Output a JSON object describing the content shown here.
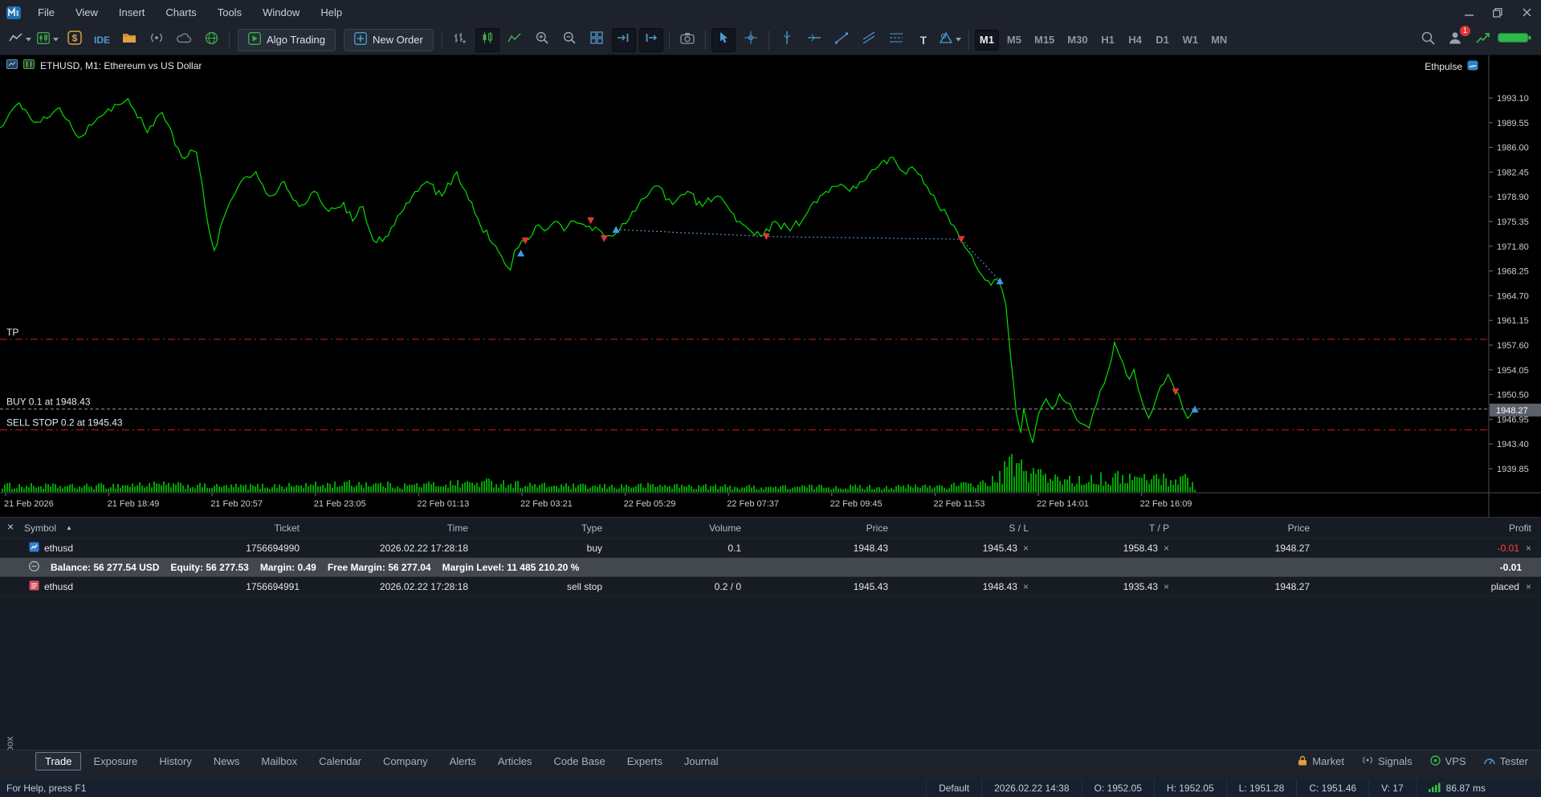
{
  "menubar": {
    "items": [
      "File",
      "View",
      "Insert",
      "Charts",
      "Tools",
      "Window",
      "Help"
    ]
  },
  "toolbar": {
    "ide_label": "IDE",
    "algo_trading_label": "Algo Trading",
    "new_order_label": "New Order",
    "text_tool_glyph": "T",
    "timeframes": [
      "M1",
      "M5",
      "M15",
      "M30",
      "H1",
      "H4",
      "D1",
      "W1",
      "MN"
    ],
    "active_timeframe": "M1",
    "notification_badge": "1"
  },
  "chart": {
    "header": "ETHUSD, M1:  Ethereum vs US Dollar",
    "overlay_right": "Ethpulse",
    "price_scale": [
      "1993.10",
      "1989.55",
      "1986.00",
      "1982.45",
      "1978.90",
      "1975.35",
      "1971.80",
      "1968.25",
      "1964.70",
      "1961.15",
      "1957.60",
      "1954.05",
      "1950.50",
      "1946.95",
      "1943.40",
      "1939.85"
    ],
    "current_price": "1948.27",
    "time_axis": [
      "21 Feb 2026",
      "21 Feb 18:49",
      "21 Feb 20:57",
      "21 Feb 23:05",
      "22 Feb 01:13",
      "22 Feb 03:21",
      "22 Feb 05:29",
      "22 Feb 07:37",
      "22 Feb 09:45",
      "22 Feb 11:53",
      "22 Feb 14:01",
      "22 Feb 16:09"
    ],
    "levels": [
      {
        "label": "TP",
        "price": 1958.43,
        "color": "#cf1d1d",
        "dash": "9,4,2,4"
      },
      {
        "label": "BUY 0.1 at 1948.43",
        "price": 1948.43,
        "color": "#8f959d",
        "dash": "4,3"
      },
      {
        "label": "SELL STOP 0.2 at 1945.43",
        "price": 1945.43,
        "color": "#cf1d1d",
        "dash": "9,4,2,4"
      }
    ]
  },
  "chart_data": {
    "type": "line",
    "symbol": "ETHUSD",
    "timeframe": "M1",
    "title": "Ethereum vs US Dollar",
    "x_range": [
      "21 Feb 2026",
      "22 Feb 16:09"
    ],
    "y_range": [
      1939.85,
      1993.1
    ],
    "grid": false,
    "line_color": "#00e000",
    "volume_color": "#00a400",
    "noise": 0.7,
    "price_points": [
      [
        0.0,
        1988.8
      ],
      [
        0.013,
        1992.4
      ],
      [
        0.023,
        1989.6
      ],
      [
        0.04,
        1991.7
      ],
      [
        0.053,
        1987.4
      ],
      [
        0.066,
        1990.3
      ],
      [
        0.086,
        1993.0
      ],
      [
        0.099,
        1988.1
      ],
      [
        0.109,
        1991.0
      ],
      [
        0.122,
        1984.6
      ],
      [
        0.132,
        1985.3
      ],
      [
        0.14,
        1974.7
      ],
      [
        0.144,
        1971.2
      ],
      [
        0.152,
        1976.8
      ],
      [
        0.162,
        1981.1
      ],
      [
        0.172,
        1982.5
      ],
      [
        0.181,
        1979.0
      ],
      [
        0.191,
        1981.1
      ],
      [
        0.201,
        1977.5
      ],
      [
        0.211,
        1979.7
      ],
      [
        0.221,
        1976.8
      ],
      [
        0.231,
        1978.1
      ],
      [
        0.237,
        1975.4
      ],
      [
        0.244,
        1977.5
      ],
      [
        0.251,
        1972.6
      ],
      [
        0.261,
        1973.3
      ],
      [
        0.267,
        1976.1
      ],
      [
        0.277,
        1979.0
      ],
      [
        0.287,
        1981.1
      ],
      [
        0.297,
        1979.0
      ],
      [
        0.307,
        1982.5
      ],
      [
        0.313,
        1979.7
      ],
      [
        0.323,
        1974.7
      ],
      [
        0.333,
        1971.9
      ],
      [
        0.343,
        1968.4
      ],
      [
        0.346,
        1971.2
      ],
      [
        0.353,
        1972.6
      ],
      [
        0.36,
        1974.7
      ],
      [
        0.366,
        1974.0
      ],
      [
        0.373,
        1975.4
      ],
      [
        0.379,
        1974.0
      ],
      [
        0.386,
        1975.4
      ],
      [
        0.396,
        1974.7
      ],
      [
        0.406,
        1973.3
      ],
      [
        0.416,
        1974.0
      ],
      [
        0.425,
        1976.8
      ],
      [
        0.435,
        1979.0
      ],
      [
        0.443,
        1980.4
      ],
      [
        0.452,
        1977.8
      ],
      [
        0.462,
        1979.7
      ],
      [
        0.472,
        1977.5
      ],
      [
        0.482,
        1979.0
      ],
      [
        0.491,
        1976.8
      ],
      [
        0.501,
        1974.7
      ],
      [
        0.511,
        1973.3
      ],
      [
        0.521,
        1975.4
      ],
      [
        0.531,
        1974.0
      ],
      [
        0.541,
        1976.1
      ],
      [
        0.551,
        1979.0
      ],
      [
        0.561,
        1980.4
      ],
      [
        0.571,
        1979.7
      ],
      [
        0.58,
        1981.1
      ],
      [
        0.59,
        1983.2
      ],
      [
        0.6,
        1984.6
      ],
      [
        0.607,
        1982.5
      ],
      [
        0.613,
        1983.2
      ],
      [
        0.623,
        1980.4
      ],
      [
        0.63,
        1977.8
      ],
      [
        0.637,
        1976.1
      ],
      [
        0.643,
        1974.0
      ],
      [
        0.646,
        1972.6
      ],
      [
        0.653,
        1970.5
      ],
      [
        0.66,
        1967.6
      ],
      [
        0.666,
        1966.2
      ],
      [
        0.671,
        1966.9
      ],
      [
        0.676,
        1963.4
      ],
      [
        0.679,
        1956.3
      ],
      [
        0.683,
        1947.8
      ],
      [
        0.686,
        1945.0
      ],
      [
        0.688,
        1948.5
      ],
      [
        0.691,
        1945.7
      ],
      [
        0.694,
        1943.6
      ],
      [
        0.698,
        1947.8
      ],
      [
        0.703,
        1949.9
      ],
      [
        0.707,
        1948.5
      ],
      [
        0.712,
        1950.6
      ],
      [
        0.719,
        1949.2
      ],
      [
        0.726,
        1946.4
      ],
      [
        0.732,
        1945.7
      ],
      [
        0.737,
        1949.2
      ],
      [
        0.742,
        1952.0
      ],
      [
        0.745,
        1954.1
      ],
      [
        0.749,
        1958.0
      ],
      [
        0.752,
        1956.3
      ],
      [
        0.755,
        1954.9
      ],
      [
        0.759,
        1952.7
      ],
      [
        0.762,
        1954.1
      ],
      [
        0.765,
        1951.3
      ],
      [
        0.768,
        1949.2
      ],
      [
        0.772,
        1947.1
      ],
      [
        0.775,
        1948.5
      ],
      [
        0.778,
        1950.6
      ],
      [
        0.782,
        1952.0
      ],
      [
        0.785,
        1953.4
      ],
      [
        0.788,
        1952.0
      ],
      [
        0.792,
        1950.6
      ],
      [
        0.795,
        1948.5
      ],
      [
        0.798,
        1947.1
      ],
      [
        0.802,
        1948.3
      ]
    ],
    "volume_envelope": [
      [
        0,
        12
      ],
      [
        0.05,
        10
      ],
      [
        0.1,
        14
      ],
      [
        0.15,
        10
      ],
      [
        0.2,
        12
      ],
      [
        0.24,
        16
      ],
      [
        0.27,
        12
      ],
      [
        0.3,
        15
      ],
      [
        0.33,
        18
      ],
      [
        0.36,
        12
      ],
      [
        0.4,
        10
      ],
      [
        0.44,
        12
      ],
      [
        0.48,
        10
      ],
      [
        0.52,
        9
      ],
      [
        0.56,
        10
      ],
      [
        0.6,
        9
      ],
      [
        0.63,
        11
      ],
      [
        0.655,
        14
      ],
      [
        0.67,
        22
      ],
      [
        0.679,
        55
      ],
      [
        0.683,
        48
      ],
      [
        0.69,
        35
      ],
      [
        0.695,
        45
      ],
      [
        0.7,
        30
      ],
      [
        0.705,
        22
      ],
      [
        0.715,
        25
      ],
      [
        0.725,
        20
      ],
      [
        0.735,
        28
      ],
      [
        0.745,
        22
      ],
      [
        0.755,
        30
      ],
      [
        0.765,
        24
      ],
      [
        0.775,
        28
      ],
      [
        0.785,
        22
      ],
      [
        0.795,
        26
      ],
      [
        0.801,
        18
      ],
      [
        0.803,
        0
      ],
      [
        1,
        0
      ]
    ],
    "markers": [
      {
        "t": 0.35,
        "price": 1970.8,
        "color": "blue",
        "dir": "up"
      },
      {
        "t": 0.353,
        "price": 1972.6,
        "color": "red",
        "dir": "down"
      },
      {
        "t": 0.397,
        "price": 1975.5,
        "color": "red",
        "dir": "down"
      },
      {
        "t": 0.406,
        "price": 1972.9,
        "color": "red",
        "dir": "down"
      },
      {
        "t": 0.414,
        "price": 1974.2,
        "color": "blue",
        "dir": "up"
      },
      {
        "t": 0.515,
        "price": 1973.2,
        "color": "red",
        "dir": "down"
      },
      {
        "t": 0.646,
        "price": 1972.8,
        "color": "red",
        "dir": "down"
      },
      {
        "t": 0.672,
        "price": 1966.8,
        "color": "blue",
        "dir": "up"
      },
      {
        "t": 0.79,
        "price": 1950.9,
        "color": "red",
        "dir": "down"
      },
      {
        "t": 0.803,
        "price": 1948.4,
        "color": "blue",
        "dir": "up"
      }
    ],
    "trade_lines": [
      [
        [
          0.414,
          1974.2
        ],
        [
          0.515,
          1973.2
        ],
        [
          0.646,
          1972.8
        ]
      ],
      [
        [
          0.646,
          1972.8
        ],
        [
          0.672,
          1966.8
        ]
      ]
    ]
  },
  "trade_panel": {
    "columns": [
      "Symbol",
      "Ticket",
      "Time",
      "Type",
      "Volume",
      "Price",
      "S / L",
      "T / P",
      "Price",
      "Profit"
    ],
    "sort_glyph": "▲",
    "close_glyph": "×",
    "rows": [
      {
        "symbol": "ethusd",
        "ticket": "1756694990",
        "time": "2026.02.22 17:28:18",
        "type": "buy",
        "volume": "0.1",
        "price": "1948.43",
        "sl": "1945.43",
        "tp": "1958.43",
        "price2": "1948.27",
        "profit": "-0.01"
      },
      {
        "symbol": "ethusd",
        "ticket": "1756694991",
        "time": "2026.02.22 17:28:18",
        "type": "sell stop",
        "volume": "0.2 / 0",
        "price": "1945.43",
        "sl": "1948.43",
        "tp": "1935.43",
        "price2": "1948.27",
        "profit": "placed"
      }
    ],
    "balance_row": {
      "parts": [
        "Balance: 56 277.54 USD",
        "Equity: 56 277.53",
        "Margin: 0.49",
        "Free Margin: 56 277.04",
        "Margin Level: 11 485 210.20 %"
      ],
      "profit": "-0.01"
    }
  },
  "tabs": {
    "side_label": "Toolbox",
    "items": [
      "Trade",
      "Exposure",
      "History",
      "News",
      "Mailbox",
      "Calendar",
      "Company",
      "Alerts",
      "Articles",
      "Code Base",
      "Experts",
      "Journal"
    ],
    "active": "Trade",
    "right_items": [
      "Market",
      "Signals",
      "VPS",
      "Tester"
    ]
  },
  "status_bar": {
    "help": "For Help, press F1",
    "profile": "Default",
    "time": "2026.02.22 14:38",
    "open": "O: 1952.05",
    "high": "H: 1952.05",
    "low": "L: 1951.28",
    "close": "C: 1951.46",
    "volume": "V: 17",
    "latency": "86.87 ms"
  },
  "icons": [
    "mt5-logo-icon",
    "new-chart-icon",
    "chart-profile-icon",
    "dollar-symbols-icon",
    "folder-icon",
    "broadcast-icon",
    "cloud-icon",
    "globe-icon",
    "algo-play-icon",
    "new-order-plus-icon",
    "bar-chart-icon",
    "candlestick-icon",
    "line-chart-icon",
    "zoom-in-icon",
    "zoom-out-icon",
    "tile-windows-icon",
    "auto-scroll-icon",
    "chart-shift-icon",
    "camera-icon",
    "cursor-icon",
    "crosshair-icon",
    "vertical-line-icon",
    "horizontal-line-icon",
    "trendline-icon",
    "channel-icon",
    "fibonacci-icon",
    "text-tool-icon",
    "shapes-icon",
    "search-icon",
    "profile-icon",
    "stats-icon",
    "battery-icon",
    "lock-icon",
    "signal-icon",
    "vps-icon",
    "tester-icon",
    "wifi-bars-icon"
  ]
}
